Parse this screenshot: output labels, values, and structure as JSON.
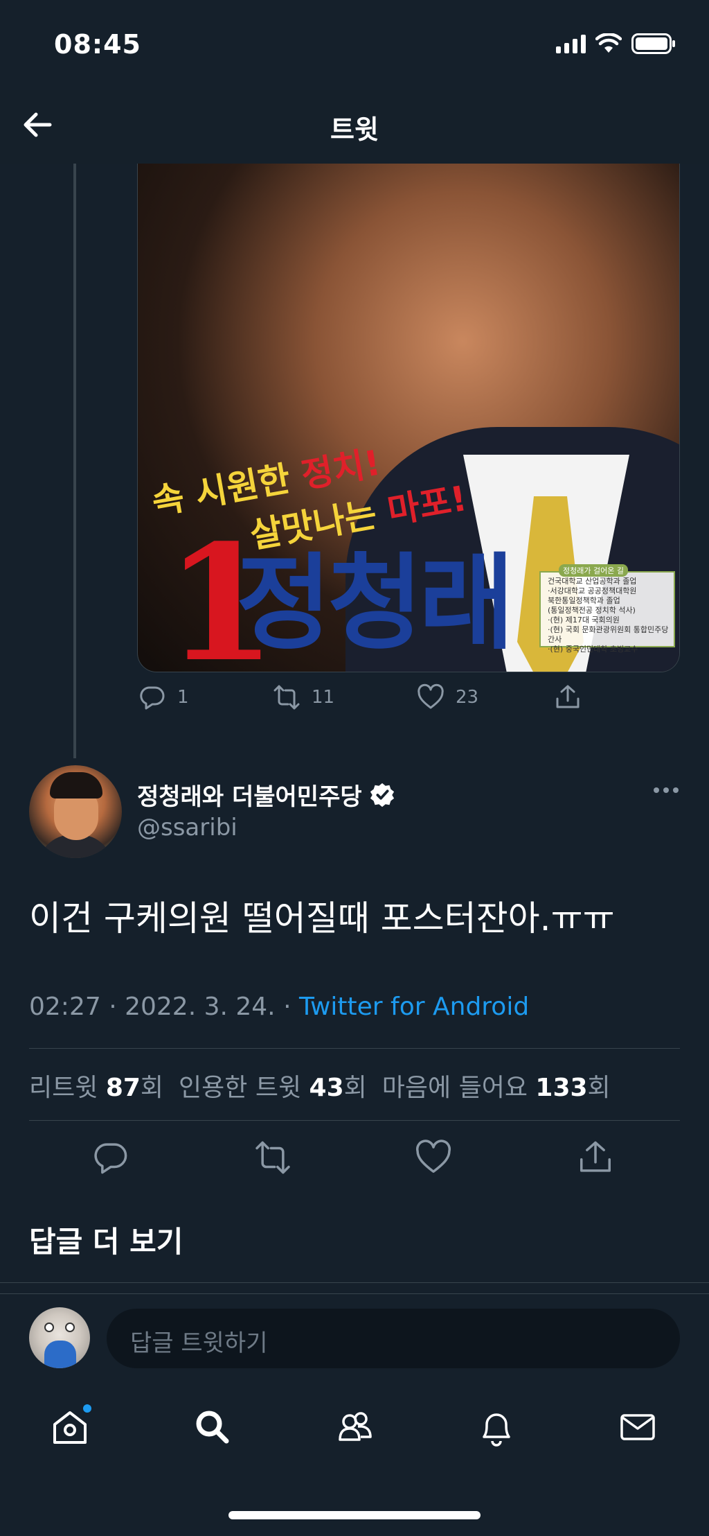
{
  "status_bar": {
    "time": "08:45"
  },
  "header": {
    "title": "트윗"
  },
  "image": {
    "slogan_line1": "속 시원한",
    "slogan_line1_red": "정치!",
    "slogan_line2": "살맛나는",
    "slogan_line2_red": "마포!",
    "number": "1",
    "name": "정청래",
    "bio_title": "정청래가 걸어온 길",
    "bio_lines": [
      "건국대학교 산업공학과 졸업",
      "·서강대학교 공공정책대학원",
      "북한통일정책학과 졸업",
      "(통일정책전공 정치학 석사)",
      "·(현) 제17대 국회의원",
      "·(현) 국회 문화관광위원회 통합민주당 간사",
      "·(현) 중국인민대학 초빙교수"
    ]
  },
  "parent_tweet": {
    "reply_count": "1",
    "retweet_count": "11",
    "like_count": "23"
  },
  "tweet": {
    "display_name": "정청래와 더불어민주당",
    "handle": "@ssaribi",
    "text": "이건 구케의원 떨어질때 포스터잔아.ㅠㅠ",
    "timestamp": "02:27 · 2022. 3. 24. · ",
    "source": "Twitter for Android",
    "stats": {
      "retweets_label": "리트윗 ",
      "retweets": "87",
      "retweets_unit": "회",
      "quotes_label": "인용한 트윗 ",
      "quotes": "43",
      "quotes_unit": "회",
      "likes_label": "마음에 들어요 ",
      "likes": "133",
      "likes_unit": "회"
    }
  },
  "more_replies": "답글 더 보기",
  "reply_bar": {
    "placeholder": "답글 트윗하기"
  },
  "bottom_nav": {
    "items": [
      "home-icon",
      "search-icon",
      "communities-icon",
      "notifications-icon",
      "messages-icon"
    ],
    "home_has_badge": true
  },
  "colors": {
    "background": "#15202b",
    "accent": "#1d9bf0",
    "secondary_text": "#8b98a5",
    "divider": "#38444d"
  }
}
